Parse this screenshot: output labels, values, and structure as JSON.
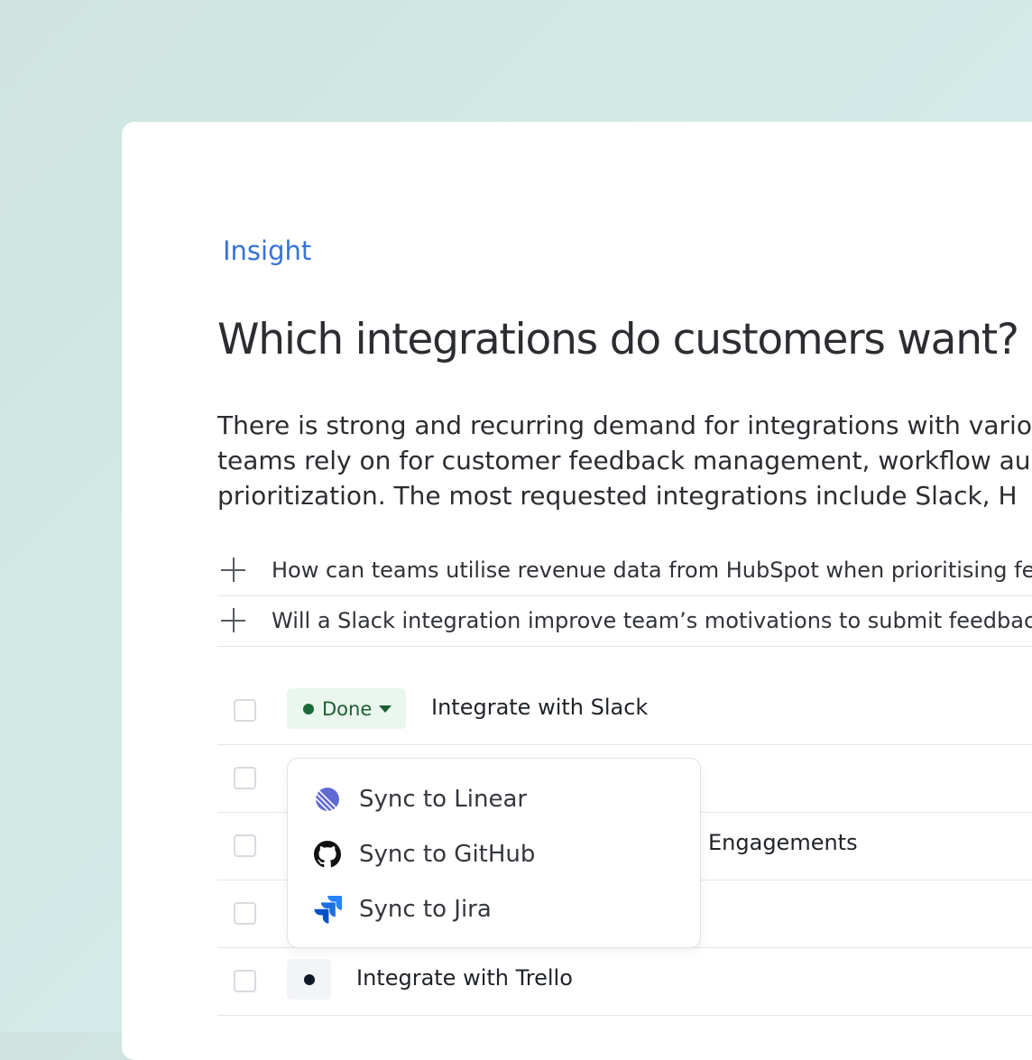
{
  "insight": {
    "eyebrow": "Insight",
    "title": "Which integrations do customers want?",
    "description_lines": [
      "There is strong and recurring demand for integrations with vario",
      "teams rely on for customer feedback management, workflow au",
      "prioritization. The most requested integrations include Slack, H"
    ]
  },
  "questions": [
    {
      "text": "How can teams utilise revenue data from HubSpot when prioritising feature"
    },
    {
      "text": "Will a Slack integration improve team’s motivations to submit feedback?"
    }
  ],
  "tasks": [
    {
      "status": "Done",
      "title": "Integrate with Slack"
    },
    {
      "status": "",
      "title": ""
    },
    {
      "status": "",
      "title": "Engagements"
    },
    {
      "status": "",
      "title": ""
    },
    {
      "status": "",
      "title": "Integrate with Trello"
    }
  ],
  "sync_menu": {
    "items": [
      {
        "label": "Sync to Linear",
        "icon": "linear-icon"
      },
      {
        "label": "Sync to GitHub",
        "icon": "github-icon"
      },
      {
        "label": "Sync to Jira",
        "icon": "jira-icon"
      }
    ]
  },
  "colors": {
    "accent": "#3872d9",
    "done_bg": "#eaf6ee",
    "done_text": "#1b5e33",
    "linear": "#5e6ad2",
    "jira": "#2684ff"
  }
}
